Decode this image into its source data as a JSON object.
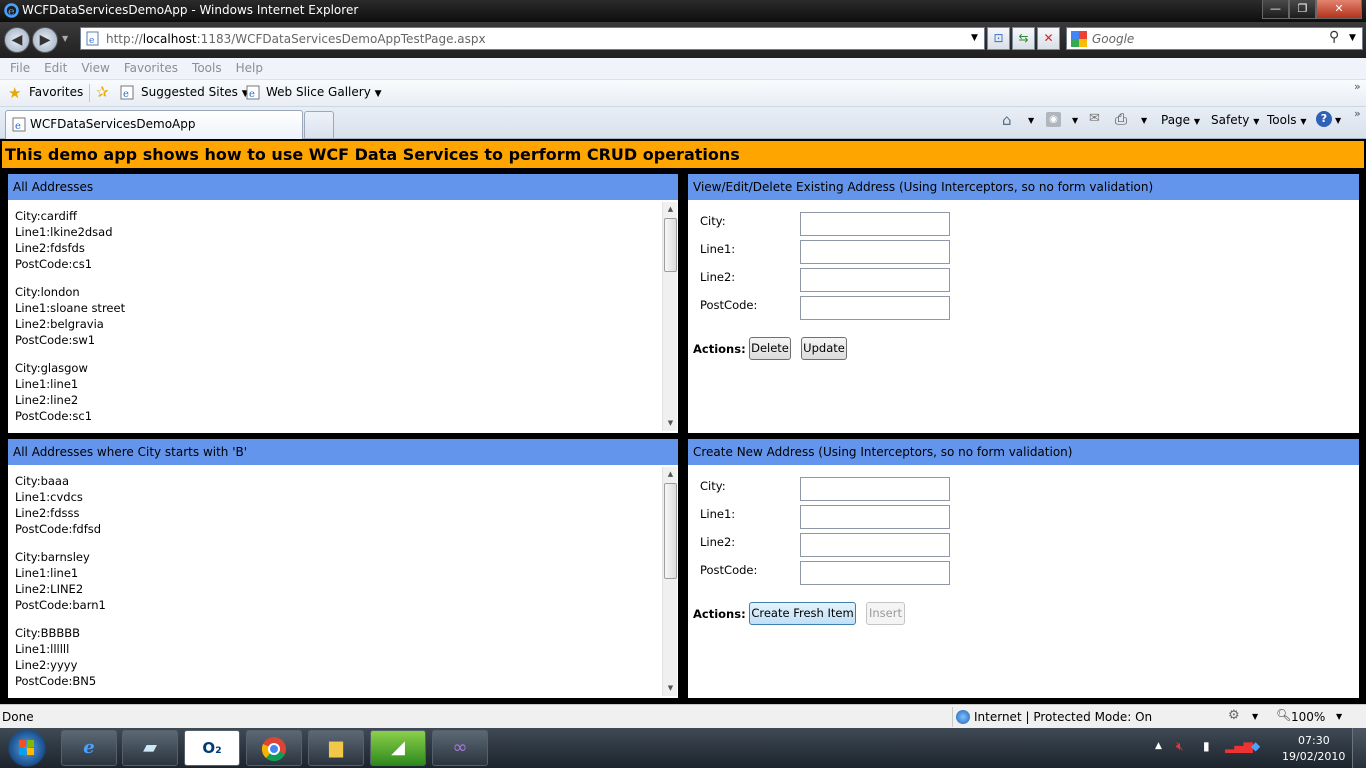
{
  "window": {
    "title": "WCFDataServicesDemoApp - Windows Internet Explorer",
    "min": "—",
    "max": "❐",
    "close": "✕"
  },
  "addressbar": {
    "url_prefix": "http://",
    "url_host": "localhost",
    "url_rest": ":1183/WCFDataServicesDemoAppTestPage.aspx",
    "search_placeholder": "Google"
  },
  "menu": [
    "File",
    "Edit",
    "View",
    "Favorites",
    "Tools",
    "Help"
  ],
  "favbar": {
    "favorites": "Favorites",
    "suggested": "Suggested Sites",
    "webslice": "Web Slice Gallery"
  },
  "tab": {
    "title": "WCFDataServicesDemoApp"
  },
  "commandbar": {
    "page": "Page",
    "safety": "Safety",
    "tools": "Tools"
  },
  "banner": "This demo app shows how to use WCF Data Services to perform CRUD operations",
  "all_addresses": {
    "header": "All Addresses",
    "items": [
      {
        "city": "City:cardiff",
        "line1": "Line1:lkine2dsad",
        "line2": "Line2:fdsfds",
        "postcode": "PostCode:cs1"
      },
      {
        "city": "City:london",
        "line1": "Line1:sloane street",
        "line2": "Line2:belgravia",
        "postcode": "PostCode:sw1"
      },
      {
        "city": "City:glasgow",
        "line1": "Line1:line1",
        "line2": "Line2:line2",
        "postcode": "PostCode:sc1"
      }
    ]
  },
  "b_addresses": {
    "header": "All Addresses where City starts with 'B'",
    "items": [
      {
        "city": "City:baaa",
        "line1": "Line1:cvdcs",
        "line2": "Line2:fdsss",
        "postcode": "PostCode:fdfsd"
      },
      {
        "city": "City:barnsley",
        "line1": "Line1:line1",
        "line2": "Line2:LINE2",
        "postcode": "PostCode:barn1"
      },
      {
        "city": "City:BBBBB",
        "line1": "Line1:llllll",
        "line2": "Line2:yyyy",
        "postcode": "PostCode:BN5"
      }
    ]
  },
  "edit_panel": {
    "header": "View/Edit/Delete Existing Address (Using Interceptors, so no form validation)",
    "city_label": "City:",
    "line1_label": "Line1:",
    "line2_label": "Line2:",
    "postcode_label": "PostCode:",
    "actions_label": "Actions:",
    "delete_button": "Delete",
    "update_button": "Update"
  },
  "create_panel": {
    "header": "Create New Address (Using Interceptors, so no form validation)",
    "city_label": "City:",
    "line1_label": "Line1:",
    "line2_label": "Line2:",
    "postcode_label": "PostCode:",
    "actions_label": "Actions:",
    "create_button": "Create Fresh Item",
    "insert_button": "Insert"
  },
  "statusbar": {
    "done": "Done",
    "zone": "Internet | Protected Mode: On",
    "zoom": "100%"
  },
  "taskbar": {
    "time": "07:30",
    "date": "19/02/2010"
  },
  "colors": {
    "banner": "#ffa500",
    "panel_header": "#6495ed"
  }
}
